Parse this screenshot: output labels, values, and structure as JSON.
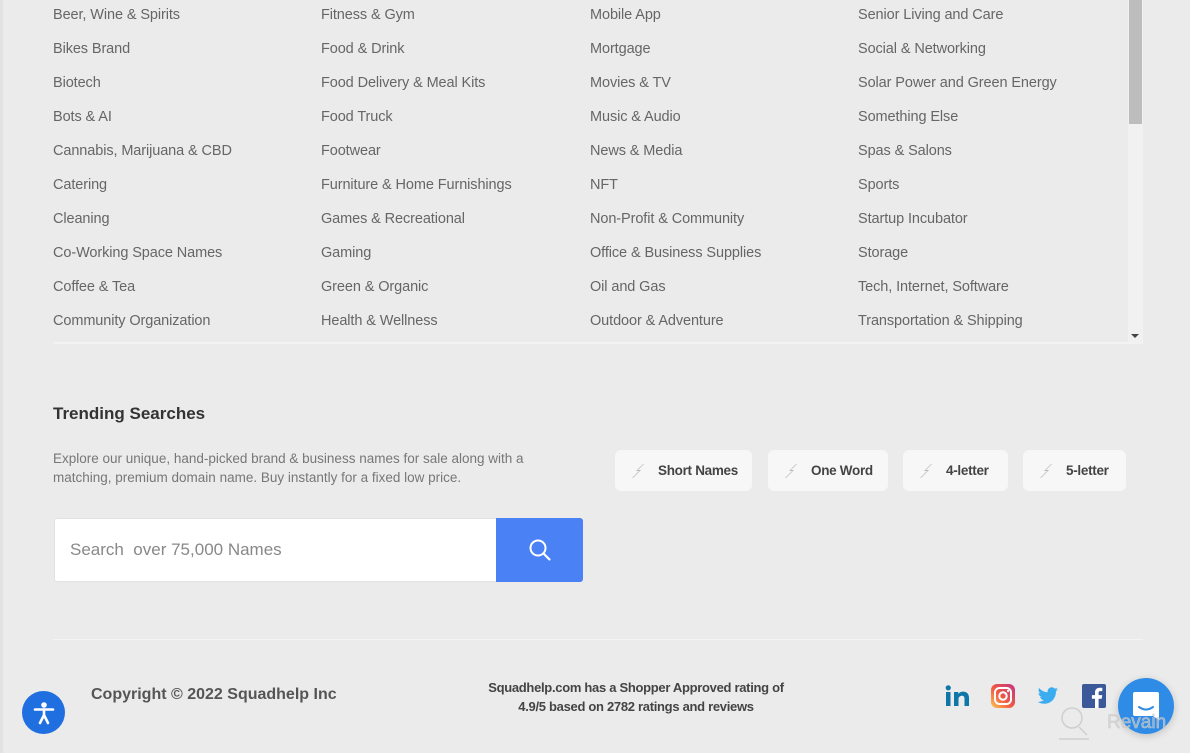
{
  "categories": {
    "columns": [
      [
        "Beer, Wine & Spirits",
        "Bikes Brand",
        "Biotech",
        "Bots & AI",
        "Cannabis, Marijuana & CBD",
        "Catering",
        "Cleaning",
        "Co-Working Space Names",
        "Coffee & Tea",
        "Community Organization"
      ],
      [
        "Fitness & Gym",
        "Food & Drink",
        "Food Delivery & Meal Kits",
        "Food Truck",
        "Footwear",
        "Furniture & Home Furnishings",
        "Games & Recreational",
        "Gaming",
        "Green & Organic",
        "Health & Wellness"
      ],
      [
        "Mobile App",
        "Mortgage",
        "Movies & TV",
        "Music & Audio",
        "News & Media",
        "NFT",
        "Non-Profit & Community",
        "Office & Business Supplies",
        "Oil and Gas",
        "Outdoor & Adventure"
      ],
      [
        "Senior Living and Care",
        "Social & Networking",
        "Solar Power and Green Energy",
        "Something Else",
        "Spas & Salons",
        "Sports",
        "Startup Incubator",
        "Storage",
        "Tech, Internet, Software",
        "Transportation & Shipping"
      ]
    ]
  },
  "trending": {
    "title": "Trending Searches",
    "description": "Explore our unique, hand-picked brand & business names for sale along with a matching, premium domain name. Buy instantly for a fixed low price.",
    "chips": [
      {
        "label": "Short Names",
        "icon": "lightning-icon"
      },
      {
        "label": "One Word",
        "icon": "lightning-icon"
      },
      {
        "label": "4-letter",
        "icon": "lightning-icon"
      },
      {
        "label": "5-letter",
        "icon": "lightning-icon"
      }
    ]
  },
  "search": {
    "placeholder": "Search  over 75,000 Names",
    "value": "",
    "button_icon": "search-icon"
  },
  "footer": {
    "copyright": "Copyright © 2022 Squadhelp Inc",
    "rating_line1": "Squadhelp.com has a Shopper Approved rating of",
    "rating_line2": "4.9/5 based on 2782 ratings and reviews",
    "social": [
      "linkedin-icon",
      "instagram-icon",
      "twitter-icon",
      "facebook-icon"
    ],
    "watermark": "Revain"
  },
  "colors": {
    "accent": "#4a81f5",
    "accessibility": "#1f6fe0",
    "chat": "#2f8ce6",
    "linkedin": "#0e76a8",
    "twitter": "#1da1f2",
    "facebook": "#3b5998"
  }
}
